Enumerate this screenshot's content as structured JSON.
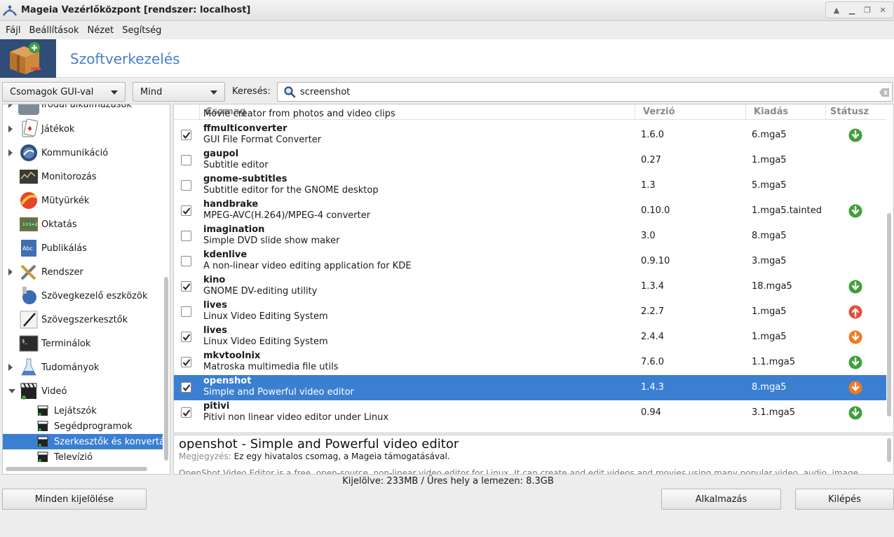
{
  "window": {
    "title": "Mageia Vezérlőközpont  [rendszer: localhost]",
    "controls": [
      "up-icon",
      "minimize-icon",
      "restore-icon",
      "close-icon"
    ]
  },
  "menu": {
    "items": [
      "Fájl",
      "Beállítások",
      "Nézet",
      "Segítség"
    ]
  },
  "header": {
    "title": "Szoftverkezelés"
  },
  "filters": {
    "type": "Csomagok GUI-val",
    "status": "Mind",
    "search_label": "Keresés:",
    "search_value": "screenshot"
  },
  "colors": {
    "accent": "#3b7fd1",
    "install_green": "#3fa03a",
    "upgrade_orange": "#f07a22",
    "remove_red": "#e84b3a",
    "header_title": "#4a80c8"
  },
  "sidebar": {
    "partial_top": "Irodai alkalmazások",
    "items": [
      {
        "label": "Játékok",
        "expander": "closed"
      },
      {
        "label": "Kommunikáció",
        "expander": "closed"
      },
      {
        "label": "Monitorozás",
        "expander": "none"
      },
      {
        "label": "Mütyürkék",
        "expander": "none"
      },
      {
        "label": "Oktatás",
        "expander": "none"
      },
      {
        "label": "Publikálás",
        "expander": "none"
      },
      {
        "label": "Rendszer",
        "expander": "closed"
      },
      {
        "label": "Szövegkezelő eszközök",
        "expander": "none"
      },
      {
        "label": "Szövegszerkesztők",
        "expander": "none"
      },
      {
        "label": "Terminálok",
        "expander": "none"
      },
      {
        "label": "Tudományok",
        "expander": "closed"
      },
      {
        "label": "Videó",
        "expander": "open"
      }
    ],
    "subitems": [
      "Lejátszók",
      "Segédprogramok",
      "Szerkesztők és konvertálók",
      "Televízió"
    ]
  },
  "columns": {
    "package": "Csomag",
    "version": "Verzió",
    "release": "Kiadás",
    "status": "Státusz"
  },
  "partial_desc": "Movie creator from photos and video clips",
  "packages": [
    {
      "name": "ffmulticonverter",
      "desc": "GUI File Format Converter",
      "version": "1.6.0",
      "release": "6.mga5",
      "checked": true,
      "status": "install-green"
    },
    {
      "name": "gaupol",
      "desc": "Subtitle editor",
      "version": "0.27",
      "release": "1.mga5",
      "checked": false,
      "status": "none"
    },
    {
      "name": "gnome-subtitles",
      "desc": "Subtitle editor for the GNOME desktop",
      "version": "1.3",
      "release": "5.mga5",
      "checked": false,
      "status": "none"
    },
    {
      "name": "handbrake",
      "desc": "MPEG-AVC(H.264)/MPEG-4 converter",
      "version": "0.10.0",
      "release": "1.mga5.tainted",
      "checked": true,
      "status": "install-green"
    },
    {
      "name": "imagination",
      "desc": "Simple DVD slide show maker",
      "version": "3.0",
      "release": "8.mga5",
      "checked": false,
      "status": "none"
    },
    {
      "name": "kdenlive",
      "desc": "A non-linear video editing application for KDE",
      "version": "0.9.10",
      "release": "3.mga5",
      "checked": false,
      "status": "none"
    },
    {
      "name": "kino",
      "desc": "GNOME DV-editing utility",
      "version": "1.3.4",
      "release": "18.mga5",
      "checked": true,
      "status": "install-green"
    },
    {
      "name": "lives",
      "desc": "Linux Video Editing System",
      "version": "2.2.7",
      "release": "1.mga5",
      "checked": false,
      "status": "upgrade-red"
    },
    {
      "name": "lives",
      "desc": "Linux Video Editing System",
      "version": "2.4.4",
      "release": "1.mga5",
      "checked": true,
      "status": "install-orange"
    },
    {
      "name": "mkvtoolnix",
      "desc": "Matroska multimedia file utils",
      "version": "7.6.0",
      "release": "1.1.mga5",
      "checked": true,
      "status": "install-green"
    },
    {
      "name": "openshot",
      "desc": "Simple and Powerful video editor",
      "version": "1.4.3",
      "release": "8.mga5",
      "checked": true,
      "status": "install-orange",
      "selected": true
    },
    {
      "name": "pitivi",
      "desc": "Pitivi non linear video editor under Linux",
      "version": "0.94",
      "release": "3.1.mga5",
      "checked": true,
      "status": "install-green"
    }
  ],
  "details": {
    "title": "openshot - Simple and Powerful video editor",
    "note_label": "Megjegyzés:",
    "note_text": "Ez egy hivatalos csomag, a Mageia támogatásával.",
    "cut_text": "OpenShot Video Editor is a free, open-source, non-linear video editor for Linux. It can create and edit videos and movies using many popular video, audio, image formats."
  },
  "status_text": "Kijelölve: 233MB / Üres hely a lemezen: 8.3GB",
  "buttons": {
    "select_all": "Minden kijelölése",
    "apply": "Alkalmazás",
    "quit": "Kilépés"
  }
}
